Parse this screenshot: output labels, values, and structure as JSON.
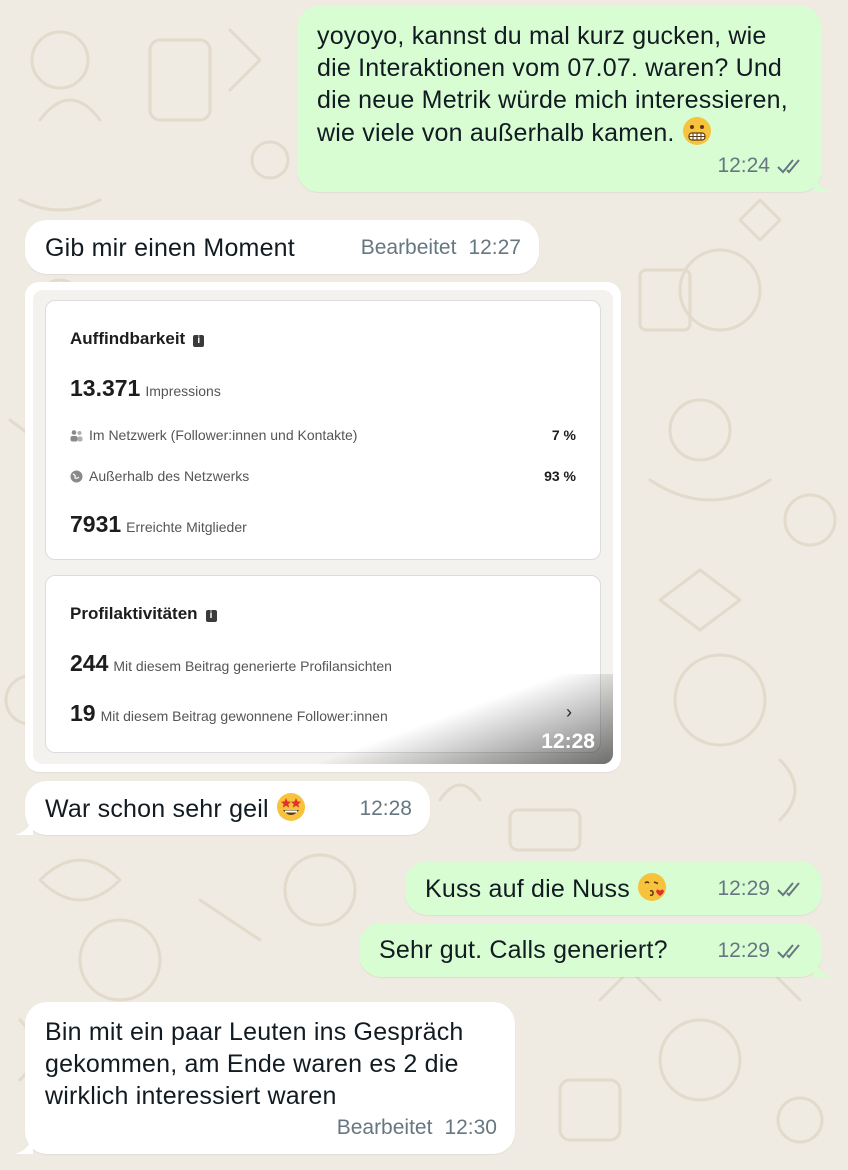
{
  "messages": {
    "m1": {
      "text": "yoyoyo, kannst du mal kurz gucken, wie die Interaktionen vom 07.07. waren? Und die neue Metrik würde mich interessieren, wie viele von außerhalb kamen.",
      "emoji": "grimacing-face",
      "time": "12:24"
    },
    "m2": {
      "text": "Gib mir einen Moment",
      "edited": "Bearbeitet",
      "time": "12:27"
    },
    "m3": {
      "time": "12:28"
    },
    "m4": {
      "text": "War schon sehr geil",
      "emoji": "star-struck-face",
      "time": "12:28"
    },
    "m5": {
      "text": "Kuss auf die Nuss",
      "emoji": "face-blowing-kiss",
      "time": "12:29"
    },
    "m6": {
      "text": "Sehr gut. Calls generiert?",
      "time": "12:29"
    },
    "m7": {
      "text": "Bin mit ein paar Leuten ins Gespräch gekommen, am Ende waren es 2 die wirklich interessiert waren",
      "edited": "Bearbeitet",
      "time": "12:30"
    }
  },
  "stats": {
    "discoverability": {
      "title": "Auffindbarkeit",
      "impressions": "13.371",
      "impressions_label": "Impressions",
      "in_network_label": "Im Netzwerk (Follower:innen und Kontakte)",
      "in_network_pct": "7 %",
      "outside_label": "Außerhalb des Netzwerks",
      "outside_pct": "93 %",
      "reached": "7931",
      "reached_label": "Erreichte Mitglieder"
    },
    "profile": {
      "title": "Profilaktivitäten",
      "views": "244",
      "views_label": "Mit diesem Beitrag generierte Profilansichten",
      "followers": "19",
      "followers_label": "Mit diesem Beitrag gewonnene Follower:innen",
      "chevron": "›"
    }
  },
  "colors": {
    "outgoing_bubble": "#d9fdd3",
    "incoming_bubble": "#ffffff",
    "wallpaper": "#efeae2",
    "read_ticks": "#667781"
  }
}
